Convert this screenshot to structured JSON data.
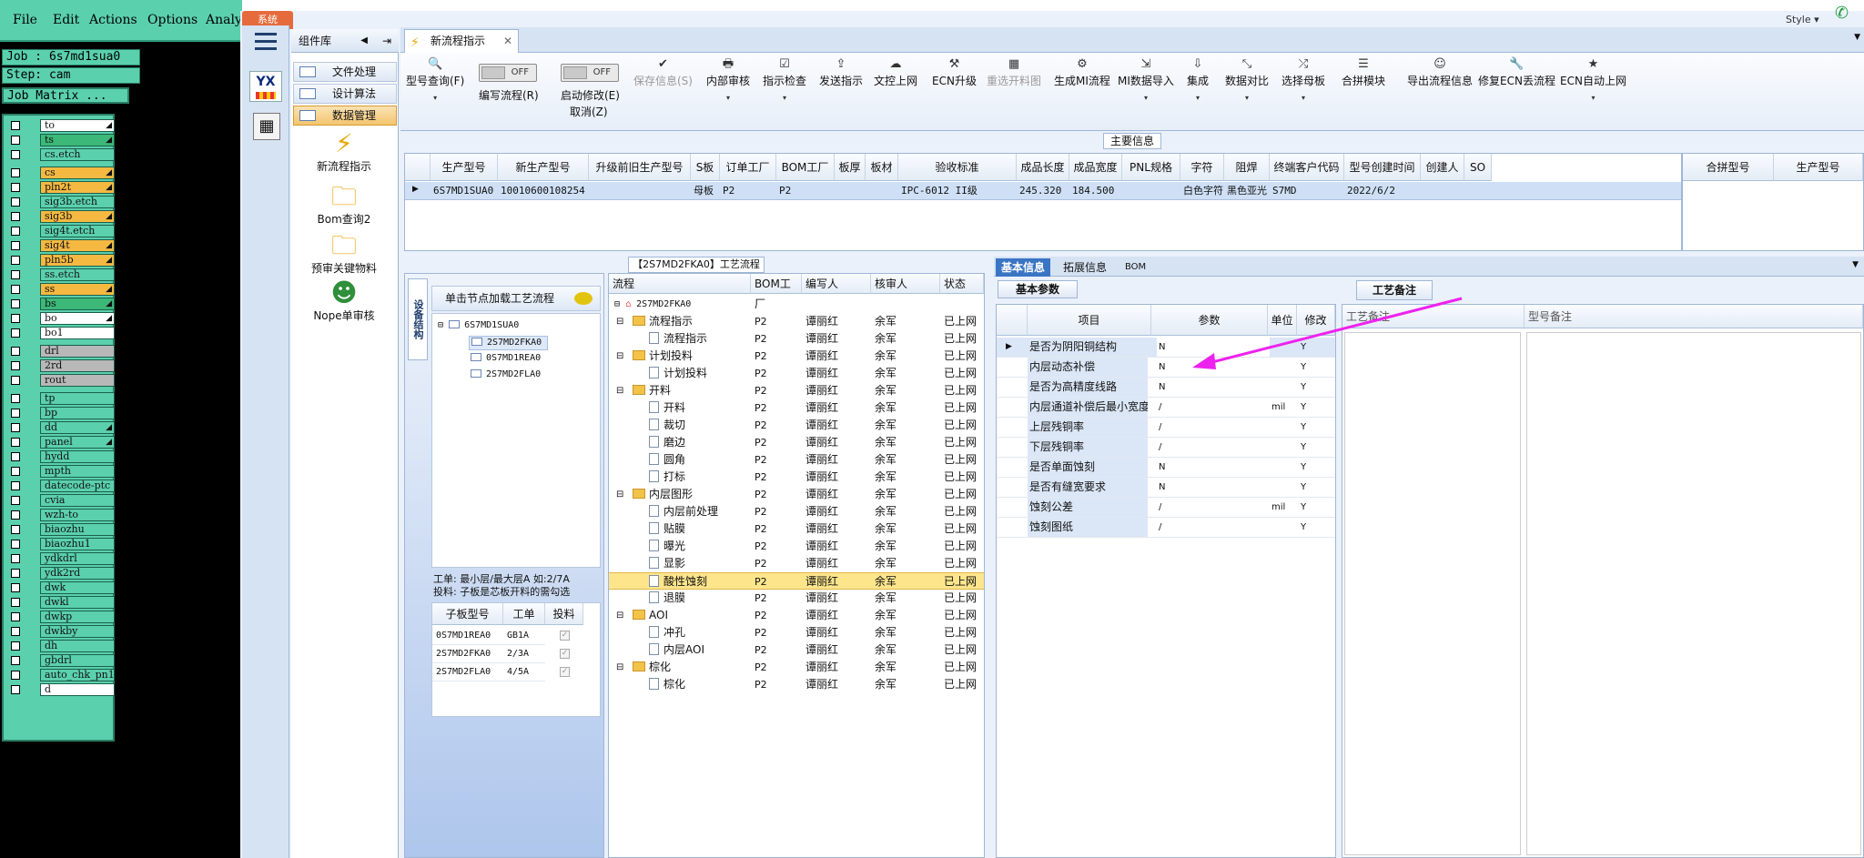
{
  "left_app": {
    "menu": [
      "File",
      "Edit",
      "Actions",
      "Options",
      "Analy"
    ],
    "job_label": "Job : 6s7md1sua0",
    "step_label": "Step: cam",
    "matrix_button": "Job Matrix ...",
    "layers": [
      {
        "name": "to",
        "color": "#ffffff",
        "mark": "◢"
      },
      {
        "name": "ts",
        "color": "#3cb878",
        "mark": "◢"
      },
      {
        "name": "cs.etch",
        "color": "#5bd0ad",
        "mark": ""
      },
      {
        "name": "cs",
        "color": "#f5b942",
        "mark": "◢"
      },
      {
        "name": "pln2t",
        "color": "#f5b942",
        "mark": "◢"
      },
      {
        "name": "sig3b.etch",
        "color": "#5bd0ad",
        "mark": ""
      },
      {
        "name": "sig3b",
        "color": "#f5b942",
        "mark": "◢"
      },
      {
        "name": "sig4t.etch",
        "color": "#5bd0ad",
        "mark": ""
      },
      {
        "name": "sig4t",
        "color": "#f5b942",
        "mark": "◢"
      },
      {
        "name": "pln5b",
        "color": "#f5b942",
        "mark": "◢"
      },
      {
        "name": "ss.etch",
        "color": "#5bd0ad",
        "mark": ""
      },
      {
        "name": "ss",
        "color": "#f5b942",
        "mark": "◢"
      },
      {
        "name": "bs",
        "color": "#3cb878",
        "mark": "◢"
      },
      {
        "name": "bo",
        "color": "#ffffff",
        "mark": "◢"
      },
      {
        "name": "bo1",
        "color": "#ffffff",
        "mark": ""
      },
      {
        "name": "drl",
        "color": "#b8b8b8",
        "mark": ""
      },
      {
        "name": "2rd",
        "color": "#b8b8b8",
        "mark": ""
      },
      {
        "name": "rout",
        "color": "#b8b8b8",
        "mark": ""
      },
      {
        "name": "tp",
        "color": "#5bd0ad",
        "mark": ""
      },
      {
        "name": "bp",
        "color": "#5bd0ad",
        "mark": ""
      },
      {
        "name": "dd",
        "color": "#5bd0ad",
        "mark": "◢"
      },
      {
        "name": "panel",
        "color": "#5bd0ad",
        "mark": "◢"
      },
      {
        "name": "hydd",
        "color": "#5bd0ad",
        "mark": ""
      },
      {
        "name": "mpth",
        "color": "#5bd0ad",
        "mark": ""
      },
      {
        "name": "datecode-ptc",
        "color": "#5bd0ad",
        "mark": ""
      },
      {
        "name": "cvia",
        "color": "#5bd0ad",
        "mark": ""
      },
      {
        "name": "wzh-to",
        "color": "#5bd0ad",
        "mark": ""
      },
      {
        "name": "biaozhu",
        "color": "#5bd0ad",
        "mark": ""
      },
      {
        "name": "biaozhu1",
        "color": "#5bd0ad",
        "mark": ""
      },
      {
        "name": "ydkdrl",
        "color": "#5bd0ad",
        "mark": ""
      },
      {
        "name": "ydk2rd",
        "color": "#5bd0ad",
        "mark": ""
      },
      {
        "name": "dwk",
        "color": "#5bd0ad",
        "mark": ""
      },
      {
        "name": "dwkl",
        "color": "#5bd0ad",
        "mark": ""
      },
      {
        "name": "dwkp",
        "color": "#5bd0ad",
        "mark": ""
      },
      {
        "name": "dwkby",
        "color": "#5bd0ad",
        "mark": ""
      },
      {
        "name": "dh",
        "color": "#5bd0ad",
        "mark": ""
      },
      {
        "name": "gbdrl",
        "color": "#5bd0ad",
        "mark": ""
      },
      {
        "name": "auto_chk_pn1",
        "color": "#5bd0ad",
        "mark": ""
      },
      {
        "name": "d",
        "color": "#ffffff",
        "mark": ""
      }
    ]
  },
  "main_app": {
    "system_tab": "系统",
    "style_label": "Style ▾",
    "nav_logo": "YX",
    "component_lib": {
      "title": "组件库",
      "items": [
        "文件处理",
        "设计算法",
        "数据管理"
      ],
      "tools": [
        "新流程指示",
        "Bom查询2",
        "预审关键物料",
        "Nope单审核"
      ]
    },
    "active_tab": "新流程指示",
    "ribbon": {
      "buttons": [
        {
          "label": "型号查询(F)",
          "icon": "🔍",
          "dd": "▾",
          "dis": false
        },
        {
          "label": "编写流程(R)",
          "icon": "",
          "dd": "",
          "dis": false
        },
        {
          "label": "启动修改(E)",
          "icon": "",
          "dd": "",
          "dis": false
        },
        {
          "label": "保存信息(S)",
          "icon": "✔",
          "dd": "",
          "dis": true
        },
        {
          "label": "内部审核",
          "icon": "🖶",
          "dd": "▾",
          "dis": false
        },
        {
          "label": "指示检查",
          "icon": "☑",
          "dd": "▾",
          "dis": false
        },
        {
          "label": "发送指示",
          "icon": "⇪",
          "dd": "",
          "dis": false
        },
        {
          "label": "文控上网",
          "icon": "☁",
          "dd": "",
          "dis": false
        },
        {
          "label": "ECN升级",
          "icon": "⚒",
          "dd": "",
          "dis": false
        },
        {
          "label": "重选开料图",
          "icon": "▦",
          "dd": "",
          "dis": true
        },
        {
          "label": "生成MI流程",
          "icon": "⚙",
          "dd": "",
          "dis": false
        },
        {
          "label": "MI数据导入",
          "icon": "⇲",
          "dd": "▾",
          "dis": false
        },
        {
          "label": "集成",
          "icon": "⇩",
          "dd": "▾",
          "dis": false
        },
        {
          "label": "数据对比",
          "icon": "⤡",
          "dd": "▾",
          "dis": false
        },
        {
          "label": "选择母板",
          "icon": "⤮",
          "dd": "▾",
          "dis": false
        },
        {
          "label": "合拼模块",
          "icon": "☰",
          "dd": "",
          "dis": false
        },
        {
          "label": "导出流程信息",
          "icon": "☺",
          "dd": "",
          "dis": false
        },
        {
          "label": "修复ECN丢流程",
          "icon": "🔧",
          "dd": "",
          "dis": false
        },
        {
          "label": "ECN自动上网",
          "icon": "★",
          "dd": "▾",
          "dis": false
        }
      ],
      "toggle_off": "OFF",
      "cancel_label": "取消(Z)"
    },
    "main_info": {
      "title": "主要信息",
      "columns": [
        "生产型号",
        "新生产型号",
        "升级前旧生产型号",
        "S板",
        "订单工厂",
        "BOM工厂",
        "板厚",
        "板材",
        "验收标准",
        "成品长度",
        "成品宽度",
        "PNL规格",
        "字符",
        "阻焊",
        "终端客户代码",
        "型号创建时间",
        "创建人",
        "SO"
      ],
      "row": {
        "生产型号": "6S7MD1SUA0",
        "新生产型号": "10010600108254",
        "S板": "母板",
        "订单工厂": "P2",
        "BOM工厂": "P2",
        "验收标准": "IPC-6012 II级",
        "成品长度": "245.320",
        "成品宽度": "184.500",
        "字符": "白色字符",
        "阻焊": "黑色亚光",
        "终端客户代码": "S7MD",
        "型号创建时间": "2022/6/2"
      },
      "merge_columns": [
        "合拼型号",
        "生产型号"
      ]
    },
    "process": {
      "title": "【2S7MD2FKA0】工艺流程",
      "vtab": "设备结构",
      "node_hint": "单击节点加载工艺流程",
      "tree_root": "6S7MD1SUA0",
      "tree_children": [
        "2S7MD2FKA0",
        "0S7MD1REA0",
        "2S7MD2FLA0"
      ],
      "info_line1": "工单: 最小层/最大层A 如:2/7A",
      "info_line2": "投料: 子板是芯板开料的需勾选",
      "sub_columns": [
        "子板型号",
        "工单",
        "投料"
      ],
      "sub_rows": [
        {
          "model": "0S7MD1REA0",
          "order": "GB1A"
        },
        {
          "model": "2S7MD2FKA0",
          "order": "2/3A"
        },
        {
          "model": "2S7MD2FLA0",
          "order": "4/5A"
        }
      ],
      "flow_columns": [
        "流程",
        "BOM工厂",
        "编写人",
        "核审人",
        "状态"
      ],
      "flow_root": "2S7MD2FKA0",
      "flow_rows": [
        {
          "name": "流程指示",
          "group": true
        },
        {
          "name": "流程指示",
          "group": false
        },
        {
          "name": "计划投料",
          "group": true
        },
        {
          "name": "计划投料",
          "group": false
        },
        {
          "name": "开料",
          "group": true
        },
        {
          "name": "开料",
          "group": false
        },
        {
          "name": "裁切",
          "group": false
        },
        {
          "name": "磨边",
          "group": false
        },
        {
          "name": "圆角",
          "group": false
        },
        {
          "name": "打标",
          "group": false
        },
        {
          "name": "内层图形",
          "group": true
        },
        {
          "name": "内层前处理",
          "group": false
        },
        {
          "name": "贴膜",
          "group": false
        },
        {
          "name": "曝光",
          "group": false
        },
        {
          "name": "显影",
          "group": false
        },
        {
          "name": "酸性蚀刻",
          "group": false,
          "selected": true
        },
        {
          "name": "退膜",
          "group": false
        },
        {
          "name": "AOI",
          "group": true
        },
        {
          "name": "冲孔",
          "group": false
        },
        {
          "name": "内层AOI",
          "group": false
        },
        {
          "name": "棕化",
          "group": true
        },
        {
          "name": "棕化",
          "group": false
        }
      ],
      "flow_factory": "P2",
      "flow_writer": "谭丽红",
      "flow_reviewer": "余军",
      "flow_status": "已上网"
    },
    "detail": {
      "tabs": [
        "基本信息",
        "拓展信息",
        "BOM"
      ],
      "sub_tab": "基本参数",
      "notes_tab": "工艺备注",
      "param_columns": [
        "项目",
        "参数",
        "单位",
        "修改"
      ],
      "params": [
        {
          "item": "是否为阴阳铜结构",
          "value": "N",
          "unit": "",
          "mod": "Y"
        },
        {
          "item": "内层动态补偿",
          "value": "N",
          "unit": "",
          "mod": "Y"
        },
        {
          "item": "是否为高精度线路",
          "value": "N",
          "unit": "",
          "mod": "Y"
        },
        {
          "item": "内层通道补偿后最小宽度",
          "value": "/",
          "unit": "mil",
          "mod": "Y"
        },
        {
          "item": "上层残铜率",
          "value": "/",
          "unit": "",
          "mod": "Y"
        },
        {
          "item": "下层残铜率",
          "value": "/",
          "unit": "",
          "mod": "Y"
        },
        {
          "item": "是否单面蚀刻",
          "value": "N",
          "unit": "",
          "mod": "Y"
        },
        {
          "item": "是否有缝宽要求",
          "value": "N",
          "unit": "",
          "mod": "Y"
        },
        {
          "item": "蚀刻公差",
          "value": "/",
          "unit": "mil",
          "mod": "Y"
        },
        {
          "item": "蚀刻图纸",
          "value": "/",
          "unit": "",
          "mod": "Y"
        }
      ],
      "notes_columns": [
        "工艺备注",
        "型号备注"
      ]
    }
  }
}
